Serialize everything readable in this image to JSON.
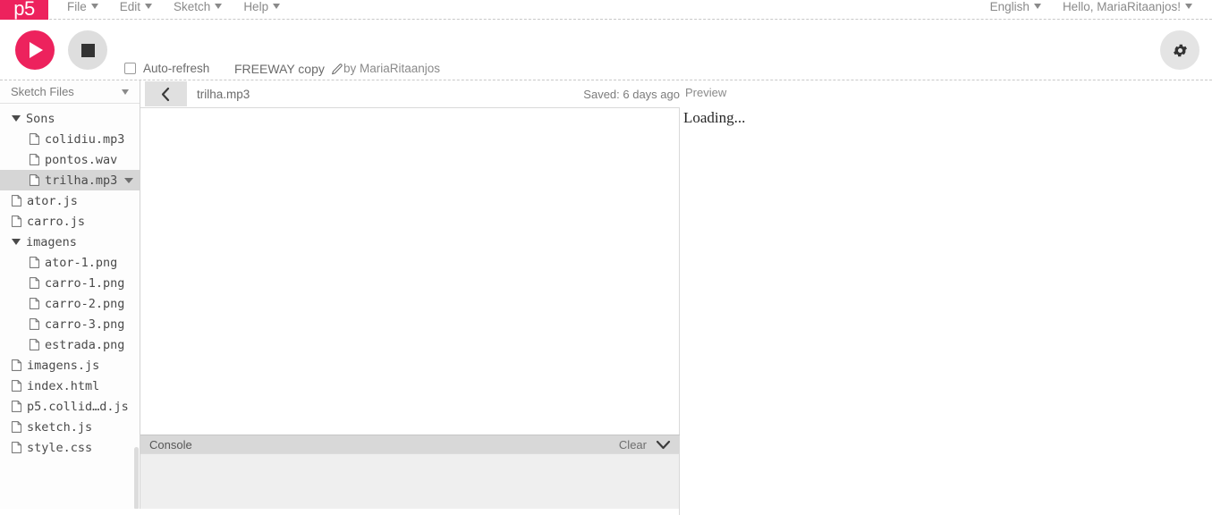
{
  "nav": {
    "left_items": [
      {
        "label": "File",
        "icon": "chevron-down-icon"
      },
      {
        "label": "Edit",
        "icon": "chevron-down-icon"
      },
      {
        "label": "Sketch",
        "icon": "chevron-down-icon"
      },
      {
        "label": "Help",
        "icon": "chevron-down-icon"
      }
    ],
    "right_items": [
      {
        "label": "English",
        "icon": "chevron-down-icon"
      },
      {
        "label": "Hello, MariaRitaanjos!",
        "icon": "chevron-down-icon"
      }
    ],
    "logo_text": "p5"
  },
  "toolbar": {
    "play_icon": "play-icon",
    "stop_icon": "stop-icon",
    "autorefresh_label": "Auto-refresh",
    "autorefresh_checked": false,
    "sketch_name": "FREEWAY copy",
    "edit_icon": "pencil-icon",
    "author": "by MariaRitaanjos",
    "settings_icon": "gear-icon"
  },
  "sidebar": {
    "title": "Sketch Files",
    "toggle_icon": "chevron-down-icon",
    "files": [
      {
        "name": "Sons",
        "type": "folder",
        "depth": 0,
        "expanded": true,
        "selected": false
      },
      {
        "name": "colidiu.mp3",
        "type": "file",
        "depth": 1,
        "selected": false
      },
      {
        "name": "pontos.wav",
        "type": "file",
        "depth": 1,
        "selected": false
      },
      {
        "name": "trilha.mp3",
        "type": "file",
        "depth": 1,
        "selected": true
      },
      {
        "name": "ator.js",
        "type": "file",
        "depth": 0,
        "selected": false
      },
      {
        "name": "carro.js",
        "type": "file",
        "depth": 0,
        "selected": false
      },
      {
        "name": "imagens",
        "type": "folder",
        "depth": 0,
        "expanded": true,
        "selected": false
      },
      {
        "name": "ator-1.png",
        "type": "file",
        "depth": 1,
        "selected": false
      },
      {
        "name": "carro-1.png",
        "type": "file",
        "depth": 1,
        "selected": false
      },
      {
        "name": "carro-2.png",
        "type": "file",
        "depth": 1,
        "selected": false
      },
      {
        "name": "carro-3.png",
        "type": "file",
        "depth": 1,
        "selected": false
      },
      {
        "name": "estrada.png",
        "type": "file",
        "depth": 1,
        "selected": false
      },
      {
        "name": "imagens.js",
        "type": "file",
        "depth": 0,
        "selected": false
      },
      {
        "name": "index.html",
        "type": "file",
        "depth": 0,
        "selected": false
      },
      {
        "name": "p5.collid…d.js",
        "type": "file",
        "depth": 0,
        "selected": false
      },
      {
        "name": "sketch.js",
        "type": "file",
        "depth": 0,
        "selected": false
      },
      {
        "name": "style.css",
        "type": "file",
        "depth": 0,
        "selected": false
      }
    ]
  },
  "editor": {
    "back_icon": "chevron-left-icon",
    "filename": "trilha.mp3",
    "saved_status": "Saved: 6 days ago",
    "content": ""
  },
  "console": {
    "title": "Console",
    "clear_label": "Clear",
    "collapse_icon": "chevron-down-icon",
    "messages": []
  },
  "preview": {
    "title": "Preview",
    "body_text": "Loading..."
  },
  "colors": {
    "brand_pink": "#ed225d",
    "toolbar_gray": "#dedede",
    "console_header": "#d8d8d8",
    "selected_row": "#d6d6d6"
  }
}
